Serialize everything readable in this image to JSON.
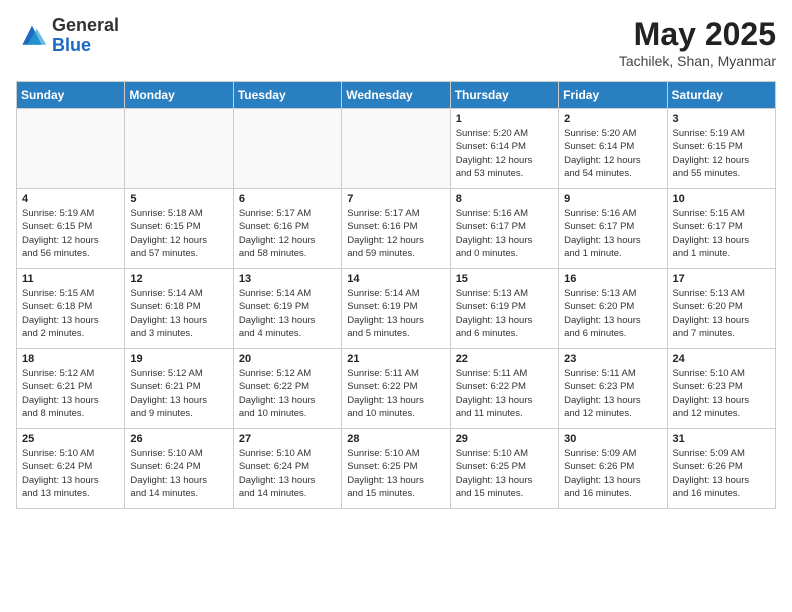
{
  "header": {
    "logo_general": "General",
    "logo_blue": "Blue",
    "month_year": "May 2025",
    "location": "Tachilek, Shan, Myanmar"
  },
  "weekdays": [
    "Sunday",
    "Monday",
    "Tuesday",
    "Wednesday",
    "Thursday",
    "Friday",
    "Saturday"
  ],
  "weeks": [
    [
      {
        "day": "",
        "info": ""
      },
      {
        "day": "",
        "info": ""
      },
      {
        "day": "",
        "info": ""
      },
      {
        "day": "",
        "info": ""
      },
      {
        "day": "1",
        "info": "Sunrise: 5:20 AM\nSunset: 6:14 PM\nDaylight: 12 hours\nand 53 minutes."
      },
      {
        "day": "2",
        "info": "Sunrise: 5:20 AM\nSunset: 6:14 PM\nDaylight: 12 hours\nand 54 minutes."
      },
      {
        "day": "3",
        "info": "Sunrise: 5:19 AM\nSunset: 6:15 PM\nDaylight: 12 hours\nand 55 minutes."
      }
    ],
    [
      {
        "day": "4",
        "info": "Sunrise: 5:19 AM\nSunset: 6:15 PM\nDaylight: 12 hours\nand 56 minutes."
      },
      {
        "day": "5",
        "info": "Sunrise: 5:18 AM\nSunset: 6:15 PM\nDaylight: 12 hours\nand 57 minutes."
      },
      {
        "day": "6",
        "info": "Sunrise: 5:17 AM\nSunset: 6:16 PM\nDaylight: 12 hours\nand 58 minutes."
      },
      {
        "day": "7",
        "info": "Sunrise: 5:17 AM\nSunset: 6:16 PM\nDaylight: 12 hours\nand 59 minutes."
      },
      {
        "day": "8",
        "info": "Sunrise: 5:16 AM\nSunset: 6:17 PM\nDaylight: 13 hours\nand 0 minutes."
      },
      {
        "day": "9",
        "info": "Sunrise: 5:16 AM\nSunset: 6:17 PM\nDaylight: 13 hours\nand 1 minute."
      },
      {
        "day": "10",
        "info": "Sunrise: 5:15 AM\nSunset: 6:17 PM\nDaylight: 13 hours\nand 1 minute."
      }
    ],
    [
      {
        "day": "11",
        "info": "Sunrise: 5:15 AM\nSunset: 6:18 PM\nDaylight: 13 hours\nand 2 minutes."
      },
      {
        "day": "12",
        "info": "Sunrise: 5:14 AM\nSunset: 6:18 PM\nDaylight: 13 hours\nand 3 minutes."
      },
      {
        "day": "13",
        "info": "Sunrise: 5:14 AM\nSunset: 6:19 PM\nDaylight: 13 hours\nand 4 minutes."
      },
      {
        "day": "14",
        "info": "Sunrise: 5:14 AM\nSunset: 6:19 PM\nDaylight: 13 hours\nand 5 minutes."
      },
      {
        "day": "15",
        "info": "Sunrise: 5:13 AM\nSunset: 6:19 PM\nDaylight: 13 hours\nand 6 minutes."
      },
      {
        "day": "16",
        "info": "Sunrise: 5:13 AM\nSunset: 6:20 PM\nDaylight: 13 hours\nand 6 minutes."
      },
      {
        "day": "17",
        "info": "Sunrise: 5:13 AM\nSunset: 6:20 PM\nDaylight: 13 hours\nand 7 minutes."
      }
    ],
    [
      {
        "day": "18",
        "info": "Sunrise: 5:12 AM\nSunset: 6:21 PM\nDaylight: 13 hours\nand 8 minutes."
      },
      {
        "day": "19",
        "info": "Sunrise: 5:12 AM\nSunset: 6:21 PM\nDaylight: 13 hours\nand 9 minutes."
      },
      {
        "day": "20",
        "info": "Sunrise: 5:12 AM\nSunset: 6:22 PM\nDaylight: 13 hours\nand 10 minutes."
      },
      {
        "day": "21",
        "info": "Sunrise: 5:11 AM\nSunset: 6:22 PM\nDaylight: 13 hours\nand 10 minutes."
      },
      {
        "day": "22",
        "info": "Sunrise: 5:11 AM\nSunset: 6:22 PM\nDaylight: 13 hours\nand 11 minutes."
      },
      {
        "day": "23",
        "info": "Sunrise: 5:11 AM\nSunset: 6:23 PM\nDaylight: 13 hours\nand 12 minutes."
      },
      {
        "day": "24",
        "info": "Sunrise: 5:10 AM\nSunset: 6:23 PM\nDaylight: 13 hours\nand 12 minutes."
      }
    ],
    [
      {
        "day": "25",
        "info": "Sunrise: 5:10 AM\nSunset: 6:24 PM\nDaylight: 13 hours\nand 13 minutes."
      },
      {
        "day": "26",
        "info": "Sunrise: 5:10 AM\nSunset: 6:24 PM\nDaylight: 13 hours\nand 14 minutes."
      },
      {
        "day": "27",
        "info": "Sunrise: 5:10 AM\nSunset: 6:24 PM\nDaylight: 13 hours\nand 14 minutes."
      },
      {
        "day": "28",
        "info": "Sunrise: 5:10 AM\nSunset: 6:25 PM\nDaylight: 13 hours\nand 15 minutes."
      },
      {
        "day": "29",
        "info": "Sunrise: 5:10 AM\nSunset: 6:25 PM\nDaylight: 13 hours\nand 15 minutes."
      },
      {
        "day": "30",
        "info": "Sunrise: 5:09 AM\nSunset: 6:26 PM\nDaylight: 13 hours\nand 16 minutes."
      },
      {
        "day": "31",
        "info": "Sunrise: 5:09 AM\nSunset: 6:26 PM\nDaylight: 13 hours\nand 16 minutes."
      }
    ]
  ]
}
